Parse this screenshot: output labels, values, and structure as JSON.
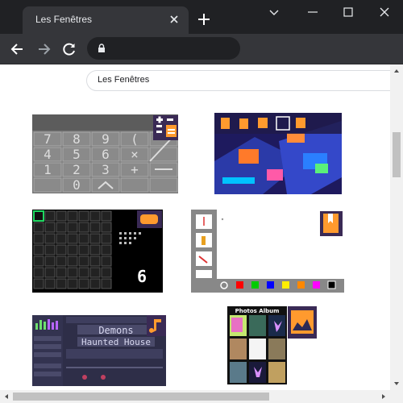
{
  "browser": {
    "tab_title": "Les Fenêtres",
    "address": ""
  },
  "page": {
    "search_value": "Les Fenêtres"
  },
  "thumbnails": {
    "calculator": {
      "keys": [
        "7",
        "8",
        "9",
        "(",
        "4",
        "5",
        "6",
        "×",
        "1",
        "2",
        "3",
        "+",
        "0"
      ]
    },
    "game": {
      "score": "6"
    },
    "music": {
      "lines": [
        "Demons",
        "Haunted House"
      ]
    },
    "photos": {
      "title": "Photos Album"
    }
  },
  "colors": {
    "titlebar": "#202124",
    "tab": "#35363a",
    "toolbar": "#35363a"
  }
}
